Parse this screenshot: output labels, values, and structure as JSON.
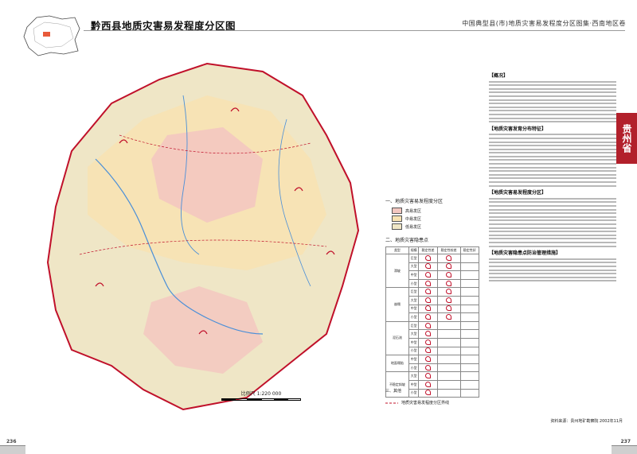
{
  "header": {
    "title": "黔西县地质灾害易发程度分区图",
    "series": "中国典型县(市)地质灾害易发程度分区图集·西南地区卷"
  },
  "page": {
    "left": "236",
    "right": "237"
  },
  "tab_label": "贵州省",
  "scale": {
    "label": "比例尺 1:220 000"
  },
  "legend": {
    "zones_title": "一、地质灾害易发程度分区",
    "zones": [
      {
        "label": "高易发区",
        "color": "#f3c7c0"
      },
      {
        "label": "中易发区",
        "color": "#f7e2b2"
      },
      {
        "label": "低易发区",
        "color": "#efe6c6"
      }
    ],
    "disasters_title": "二、地质灾害隐患点",
    "table_headers": [
      "类型",
      "规模",
      "稳定性差",
      "稳定性较差",
      "稳定性好"
    ],
    "types": [
      "滑坡",
      "崩塌",
      "泥石流",
      "地面塌陷",
      "不稳定斜坡"
    ],
    "rows": [
      [
        "巨型"
      ],
      [
        "大型"
      ],
      [
        "中型"
      ],
      [
        "小型"
      ],
      [
        "巨型"
      ],
      [
        "大型"
      ],
      [
        "中型"
      ],
      [
        "小型"
      ],
      [
        "巨型"
      ],
      [
        "大型"
      ],
      [
        "中型"
      ],
      [
        "小型"
      ],
      [
        "中型"
      ],
      [
        "小型"
      ],
      [
        "大型"
      ],
      [
        "中型"
      ],
      [
        "小型"
      ]
    ],
    "other_title": "三、其他",
    "other_item": "地质灾害易发程度分区界线"
  },
  "sidebar": {
    "sections": [
      "【概况】",
      "【地质灾害发育分布特征】",
      "【地质灾害易发程度分区】",
      "【地质灾害隐患点防治管理措施】"
    ],
    "editor": "资料来源：贵州地矿勘察院 2002年11月"
  },
  "colors": {
    "high": "#f3c7c0",
    "mid": "#f7e2b2",
    "low": "#efe6c6",
    "river": "#4a8fd8",
    "boundary": "#c0102a",
    "tab": "#b2202b"
  }
}
